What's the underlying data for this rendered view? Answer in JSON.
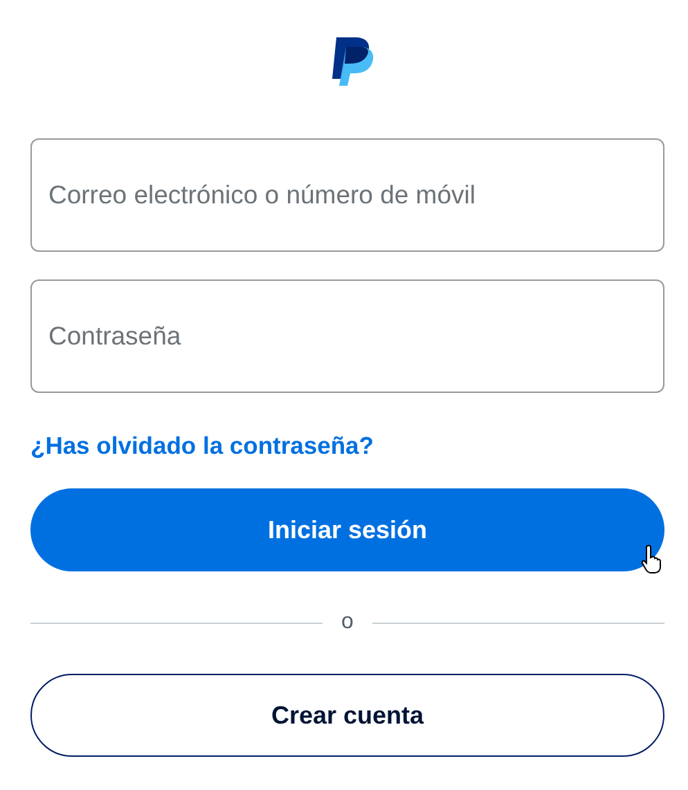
{
  "email_field": {
    "placeholder": "Correo electrónico o número de móvil"
  },
  "password_field": {
    "placeholder": "Contraseña"
  },
  "forgot_link": "¿Has olvidado la contraseña?",
  "login_button": "Iniciar sesión",
  "divider_text": "o",
  "signup_button": "Crear cuenta"
}
